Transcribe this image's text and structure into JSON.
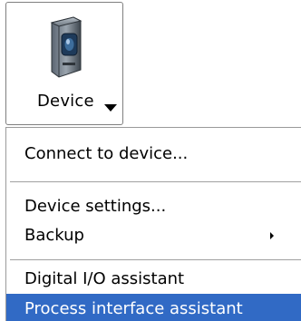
{
  "toolbar": {
    "device_button": {
      "label": "Device",
      "icon": "device-camera-icon"
    }
  },
  "menu": {
    "items": [
      {
        "label": "Connect to device...",
        "highlighted": false,
        "has_submenu": false
      },
      {
        "label": "Device settings...",
        "highlighted": false,
        "has_submenu": false
      },
      {
        "label": "Backup",
        "highlighted": false,
        "has_submenu": true
      },
      {
        "label": "Digital I/O assistant",
        "highlighted": false,
        "has_submenu": false
      },
      {
        "label": "Process interface assistant",
        "highlighted": true,
        "has_submenu": false
      }
    ]
  },
  "colors": {
    "highlight": "#316ac5",
    "highlight_text": "#ffffff",
    "border": "#7f7f7f"
  }
}
